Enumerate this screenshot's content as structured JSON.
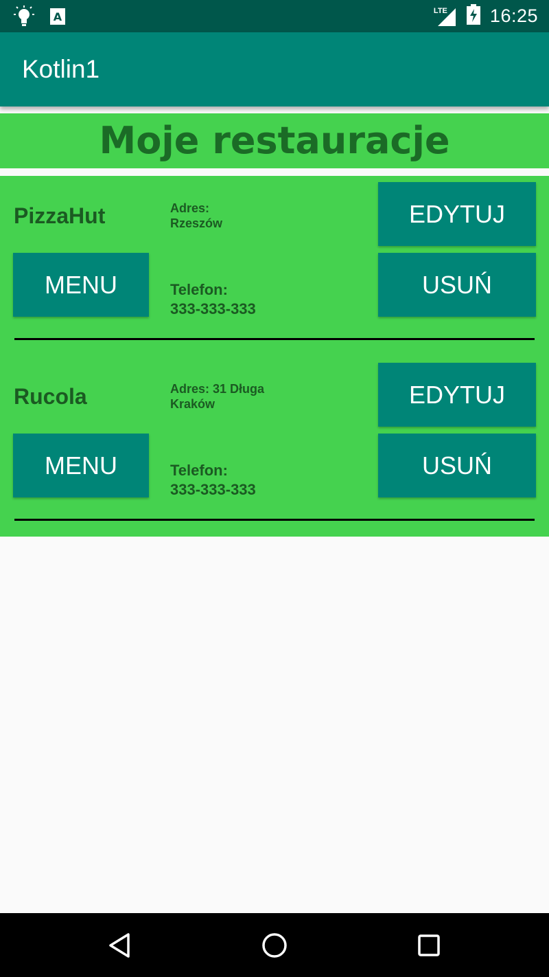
{
  "status_bar": {
    "time": "16:25",
    "network": "LTE",
    "icons": [
      "lightbulb-icon",
      "a-box-icon",
      "signal-icon",
      "battery-charging-icon"
    ]
  },
  "app_bar": {
    "title": "Kotlin1"
  },
  "header": {
    "title": "Moje restauracje"
  },
  "restaurants": [
    {
      "name": "PizzaHut",
      "address_label": "Adres:",
      "address_value": "Rzeszów",
      "phone_label": "Telefon:",
      "phone_value": "333-333-333",
      "edit_label": "EDYTUJ",
      "delete_label": "USUŃ",
      "menu_label": "MENU"
    },
    {
      "name": "Rucola",
      "address_label": "Adres: 31 Długa",
      "address_value": "Kraków",
      "phone_label": "Telefon:",
      "phone_value": "333-333-333",
      "edit_label": "EDYTUJ",
      "delete_label": "USUŃ",
      "menu_label": "MENU"
    }
  ],
  "nav_bar": {
    "icons": [
      "back-icon",
      "home-icon",
      "recents-icon"
    ]
  },
  "colors": {
    "status_bar": "#00574b",
    "app_bar": "#008577",
    "list_bg": "#45d24f",
    "button": "#008577",
    "text_dark_green": "#1b5a22"
  }
}
